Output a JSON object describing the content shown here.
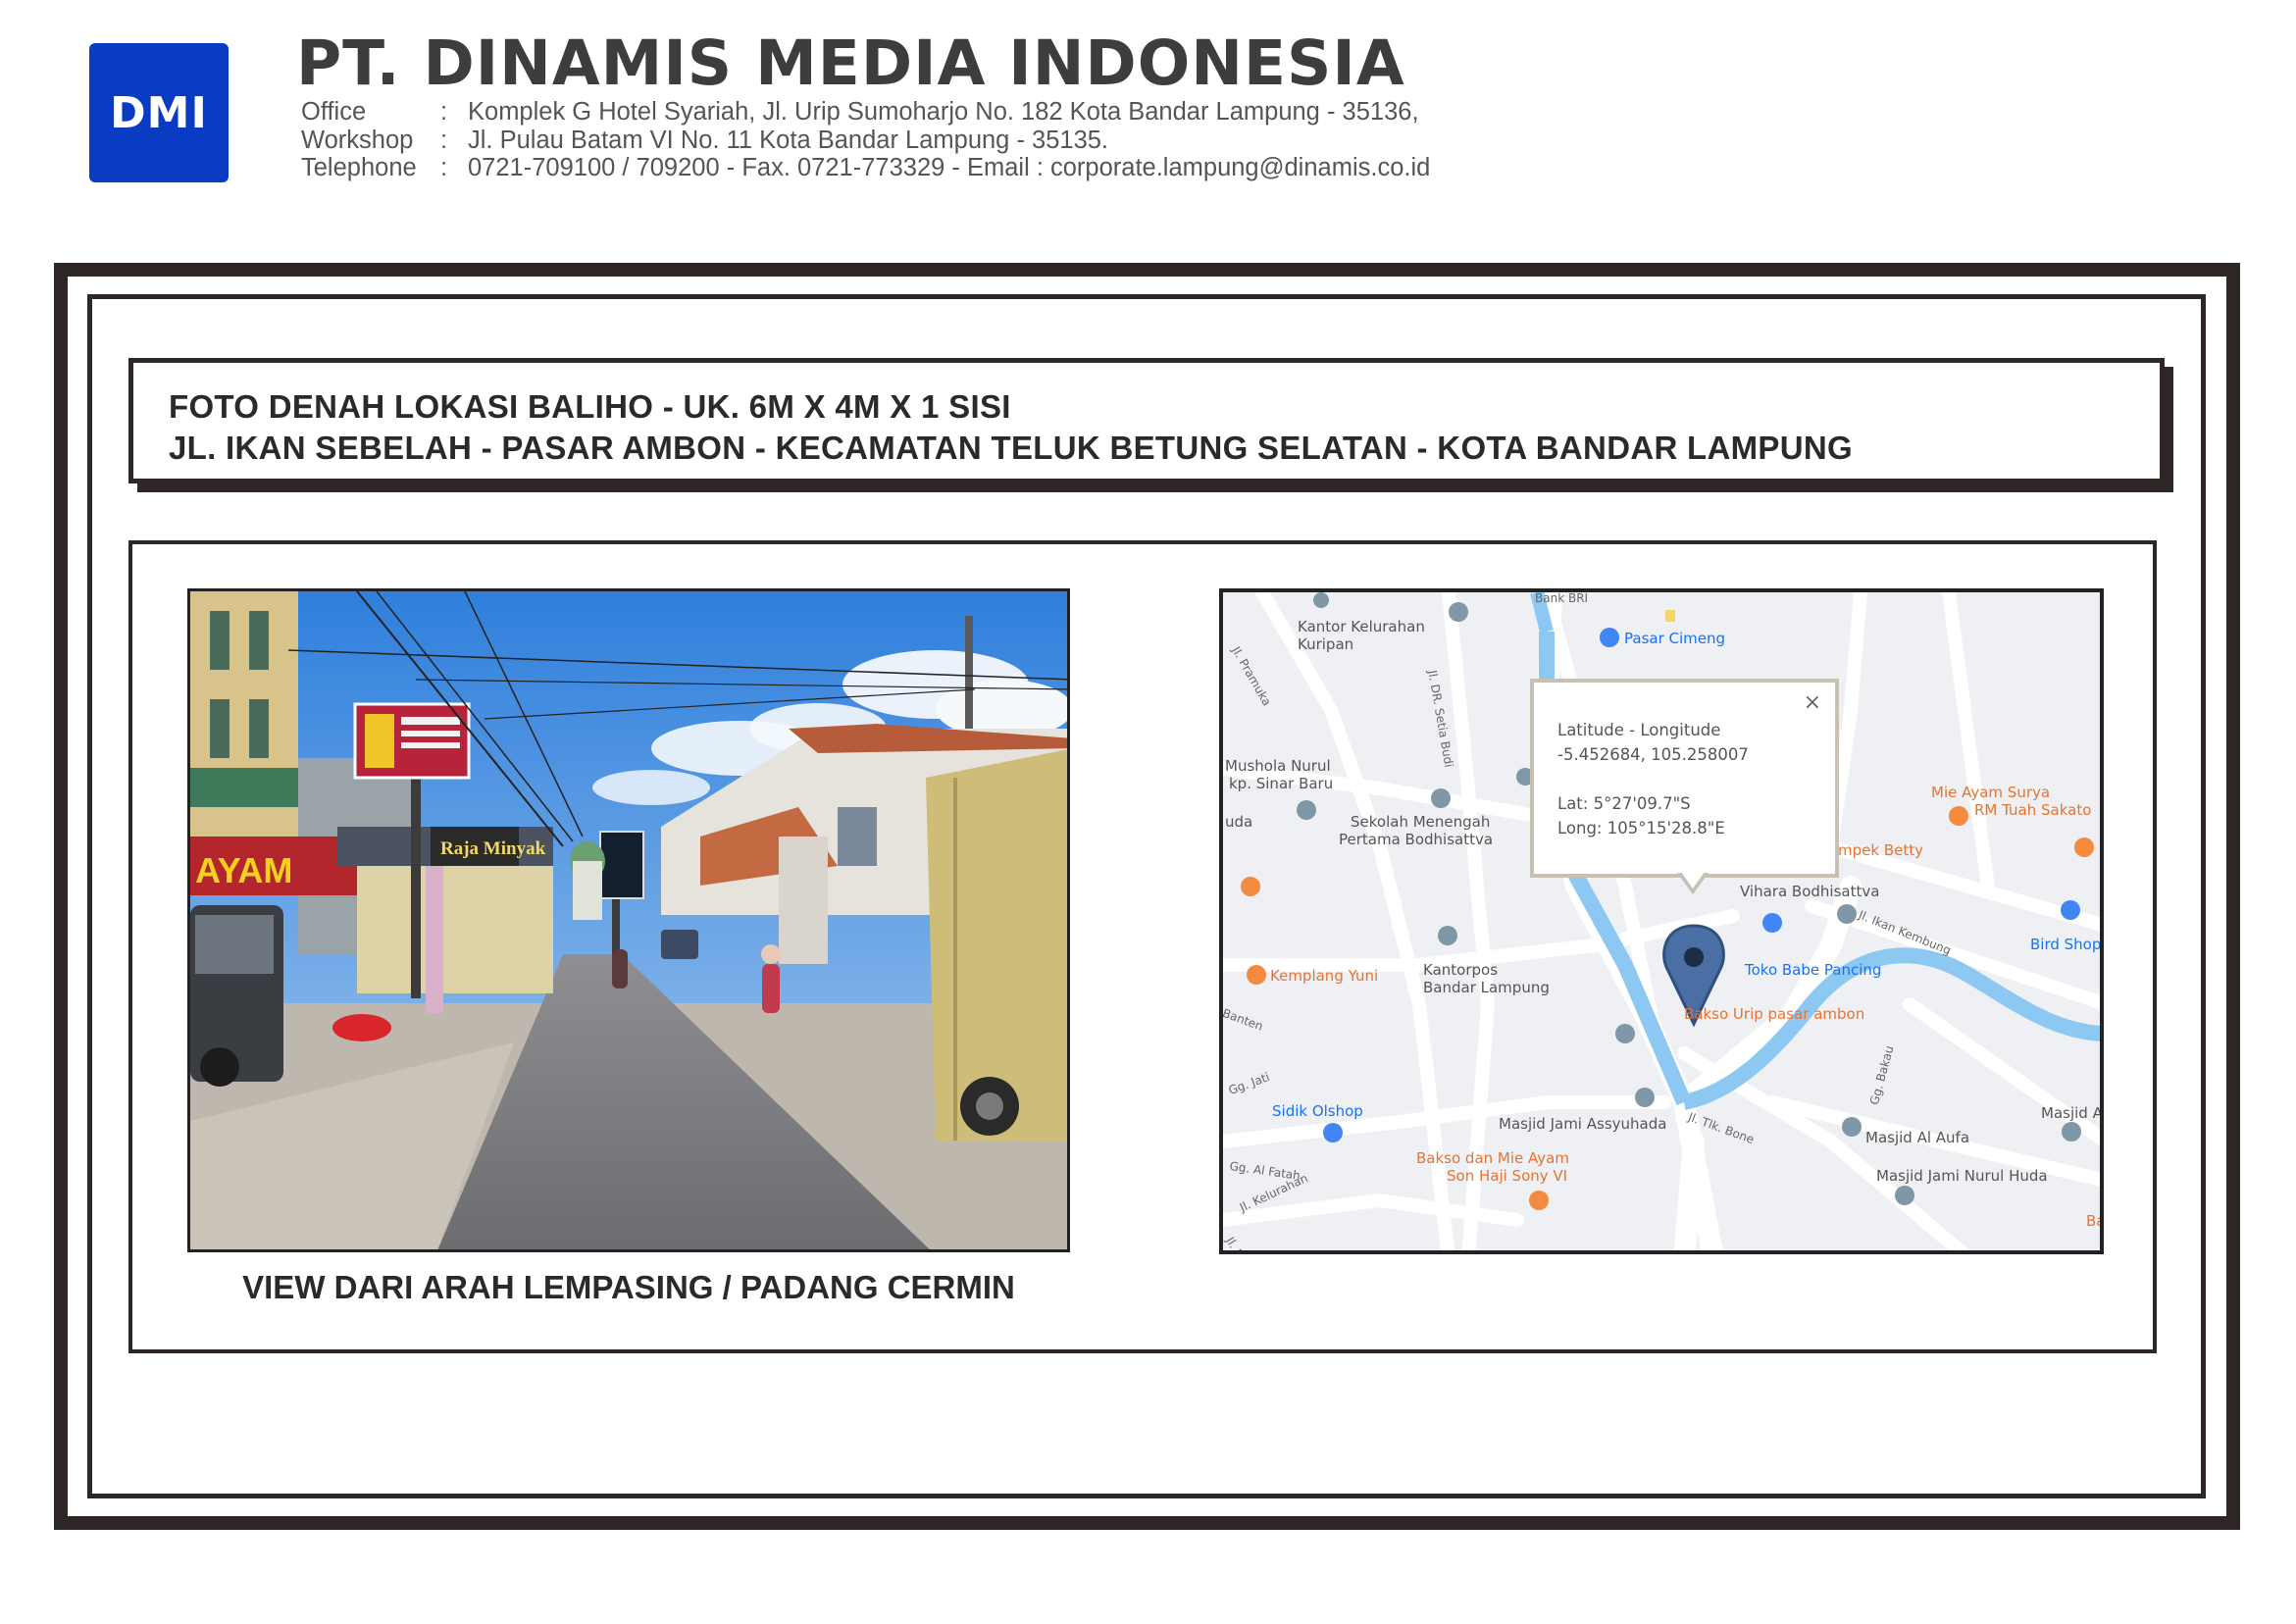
{
  "header": {
    "logo_text": "DMI",
    "company_name": "PT. DINAMIS MEDIA INDONESIA",
    "contact": [
      {
        "label": "Office",
        "sep": ":",
        "value": "Komplek G Hotel Syariah, Jl. Urip  Sumoharjo No. 182 Kota Bandar Lampung - 35136,"
      },
      {
        "label": "Workshop",
        "sep": ":",
        "value": "Jl. Pulau Batam  VI  No. 11 Kota Bandar Lampung - 35135."
      },
      {
        "label": "Telephone",
        "sep": ":",
        "value": "0721-709100 / 709200 - Fax. 0721-773329 - Email : corporate.lampung@dinamis.co.id"
      }
    ]
  },
  "title": {
    "line1": "FOTO DENAH LOKASI BALIHO - UK. 6M X 4M X 1 SISI",
    "line2": "JL. IKAN SEBELAH - PASAR AMBON - KECAMATAN TELUK BETUNG SELATAN - KOTA BANDAR LAMPUNG"
  },
  "photo": {
    "caption": "VIEW DARI ARAH LEMPASING / PADANG CERMIN",
    "signs": [
      "AYAM",
      "Raja Minyak"
    ]
  },
  "map": {
    "popup": {
      "heading": "Latitude - Longitude",
      "coords": "-5.452684, 105.258007",
      "lat": "Lat: 5°27'09.7\"S",
      "long": "Long: 105°15'28.8\"E",
      "close": "×"
    },
    "labels": {
      "bank_bri": "Bank BRI",
      "kantor_kelurahan": "Kantor Kelurahan",
      "kuripan": "Kuripan",
      "pasar_cimeng": "Pasar Cimeng",
      "jl_pramuka": "Jl. Pramuka",
      "jl_dr_setia_budi": "Jl. DR. Setia Budi",
      "mushola": "Mushola Nurul",
      "sinar_baru": "kp. Sinar Baru",
      "uda": "uda",
      "sekolah": "Sekolah Menengah",
      "pertama": "Pertama Bodhisattva",
      "mie_ayam_surya": "Mie Ayam Surya",
      "rm_tuah_sakato": "RM Tuah Sakato",
      "empek_betty": "mpek Betty",
      "vihara": "Vihara Bodhisattva",
      "jl_ikan_kembung": "Jl. Ikan Kembung",
      "bird_shop": "Bird Shop",
      "kemplang_yuni": "Kemplang Yuni",
      "kantorpos": "Kantorpos",
      "bandar_lampung": "Bandar Lampung",
      "toko_babe": "Toko Babe Pancing",
      "bakso_urip": "Bakso Urip pasar ambon",
      "banten": "Banten",
      "gg_jati": "Gg. Jati",
      "sidik_olshop": "Sidik Olshop",
      "gg_al_fatah": "Gg. Al Fatah",
      "jl_kelurahan": "Jl. Kelurahan",
      "jl_bu": "Jl. Bu",
      "masjid_assyuhada": "Masjid Jami Assyuhada",
      "jl_tlk_bone": "Jl. Tlk. Bone",
      "gg_bakau": "Gg. Bakau",
      "masjid_al_aufa": "Masjid Al Aufa",
      "masjid_a": "Masjid A",
      "bakso_mie": "Bakso dan Mie Ayam",
      "son_haji": "Son Haji Sony VI",
      "masjid_nurul_huda": "Masjid Jami Nurul Huda",
      "ba": "Ba"
    }
  }
}
